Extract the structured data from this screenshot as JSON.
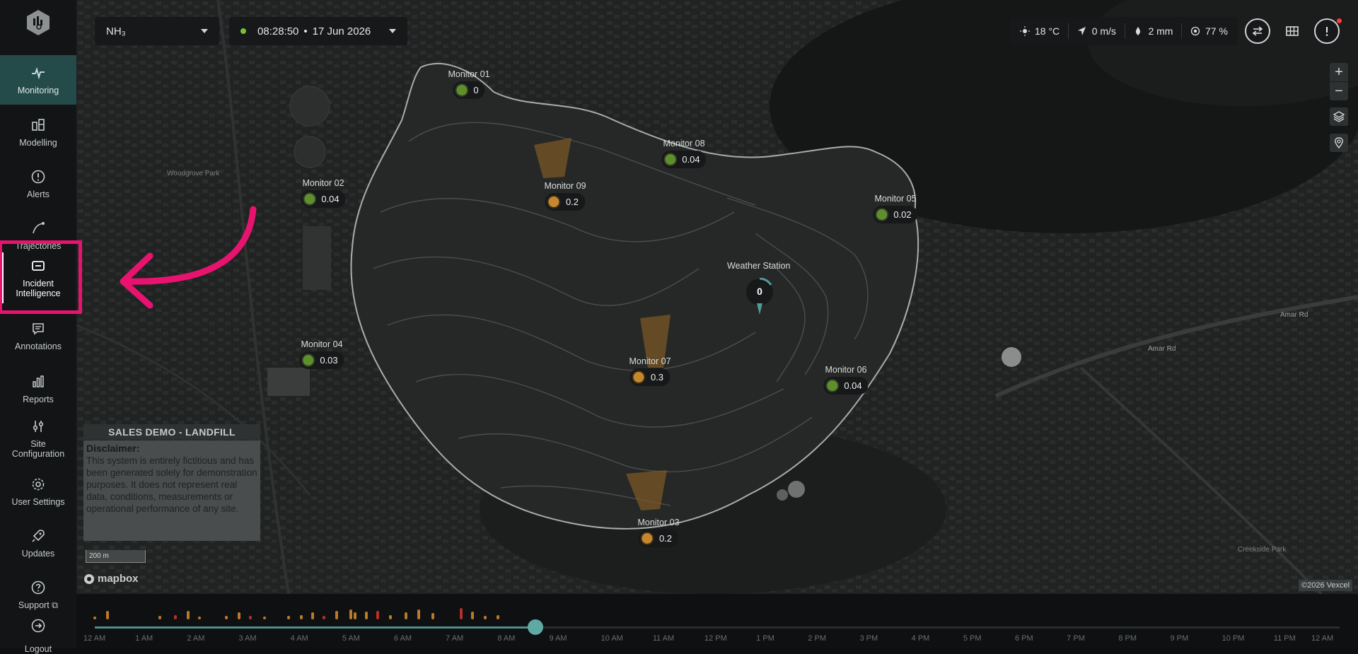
{
  "sidebar": {
    "items": [
      {
        "label": "Monitoring",
        "icon": "pulse-icon"
      },
      {
        "label": "Modelling",
        "icon": "modelling-icon"
      },
      {
        "label": "Alerts",
        "icon": "alert-icon"
      },
      {
        "label": "Trajectories",
        "icon": "trajectory-icon"
      },
      {
        "label": "Incident Intelligence",
        "icon": "incident-icon"
      },
      {
        "label": "Annotations",
        "icon": "annotation-icon"
      },
      {
        "label": "Reports",
        "icon": "reports-icon"
      },
      {
        "label": "Site Configuration",
        "icon": "sliders-icon"
      },
      {
        "label": "User Settings",
        "icon": "gear-icon"
      },
      {
        "label": "Updates",
        "icon": "rocket-icon"
      },
      {
        "label": "Support",
        "icon": "help-icon"
      },
      {
        "label": "Logout",
        "icon": "logout-icon"
      }
    ]
  },
  "topbar": {
    "pollutant": "NH₃",
    "time": "08:28:50",
    "date": "17 Jun 2026",
    "separator": "•"
  },
  "weather": {
    "temperature": "18 °C",
    "wind": "0 m/s",
    "rain": "2 mm",
    "humidity": "77 %"
  },
  "monitors": [
    {
      "name": "Monitor 01",
      "value": "0",
      "status": "green"
    },
    {
      "name": "Monitor 02",
      "value": "0.04",
      "status": "green"
    },
    {
      "name": "Monitor 03",
      "value": "0.2",
      "status": "amber"
    },
    {
      "name": "Monitor 04",
      "value": "0.03",
      "status": "green"
    },
    {
      "name": "Monitor 05",
      "value": "0.02",
      "status": "green"
    },
    {
      "name": "Monitor 06",
      "value": "0.04",
      "status": "green"
    },
    {
      "name": "Monitor 07",
      "value": "0.3",
      "status": "amber"
    },
    {
      "name": "Monitor 08",
      "value": "0.04",
      "status": "green"
    },
    {
      "name": "Monitor 09",
      "value": "0.2",
      "status": "amber"
    }
  ],
  "weather_station": {
    "name": "Weather Station",
    "value": "0"
  },
  "disclaimer": {
    "site": "SALES DEMO - LANDFILL",
    "heading": "Disclaimer:",
    "text": "This system is entirely fictitious and has been generated solely for demonstration purposes. It does not represent real data, conditions, measurements or operational performance of any site."
  },
  "map": {
    "scale": "200 m",
    "attribution": "mapbox",
    "copyright": "©2026 Vexcel",
    "labels": {
      "park1": "Woodgrove Park",
      "road1": "Amar Rd",
      "road2": "Amar Rd",
      "park2": "Creekside Park"
    }
  },
  "timeline": {
    "ticks": [
      "12 AM",
      "1 AM",
      "2 AM",
      "3 AM",
      "4 AM",
      "5 AM",
      "6 AM",
      "7 AM",
      "8 AM",
      "9 AM",
      "10 AM",
      "11 AM",
      "12 PM",
      "1 PM",
      "2 PM",
      "3 PM",
      "4 PM",
      "5 PM",
      "6 PM",
      "7 PM",
      "8 PM",
      "9 PM",
      "10 PM",
      "11 PM",
      "12 AM"
    ],
    "progress_fraction": 0.354
  },
  "colors": {
    "accent": "#244a4a",
    "highlight": "#e8136f",
    "status_green": "#5f8f2d",
    "status_amber": "#c4872e"
  }
}
